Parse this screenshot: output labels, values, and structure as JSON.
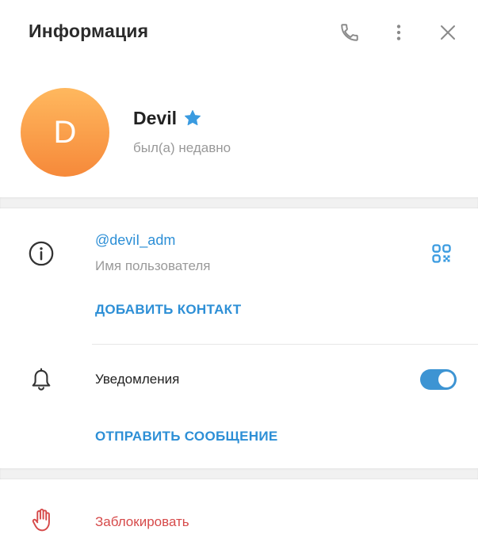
{
  "header": {
    "title": "Информация",
    "call_icon": "phone-icon",
    "more_icon": "more-vertical-icon",
    "close_icon": "close-icon"
  },
  "profile": {
    "avatar_letter": "D",
    "name": "Devil",
    "badge_icon": "star-icon",
    "status": "был(а) недавно",
    "avatar_colors": [
      "#ffb85e",
      "#f6893a"
    ]
  },
  "info": {
    "username": "@deviI_adm",
    "username_label": "Имя пользователя",
    "add_contact": "ДОБАВИТЬ КОНТАКТ",
    "qr_icon": "qr-code-icon",
    "info_icon": "info-icon"
  },
  "notifications": {
    "label": "Уведомления",
    "enabled": true,
    "send_message": "ОТПРАВИТЬ СООБЩЕНИЕ",
    "bell_icon": "bell-icon"
  },
  "block": {
    "label": "Заблокировать",
    "hand_icon": "hand-icon"
  },
  "colors": {
    "accent": "#2d8fd6",
    "toggle_on": "#3d94d3",
    "danger": "#d64a4a"
  }
}
